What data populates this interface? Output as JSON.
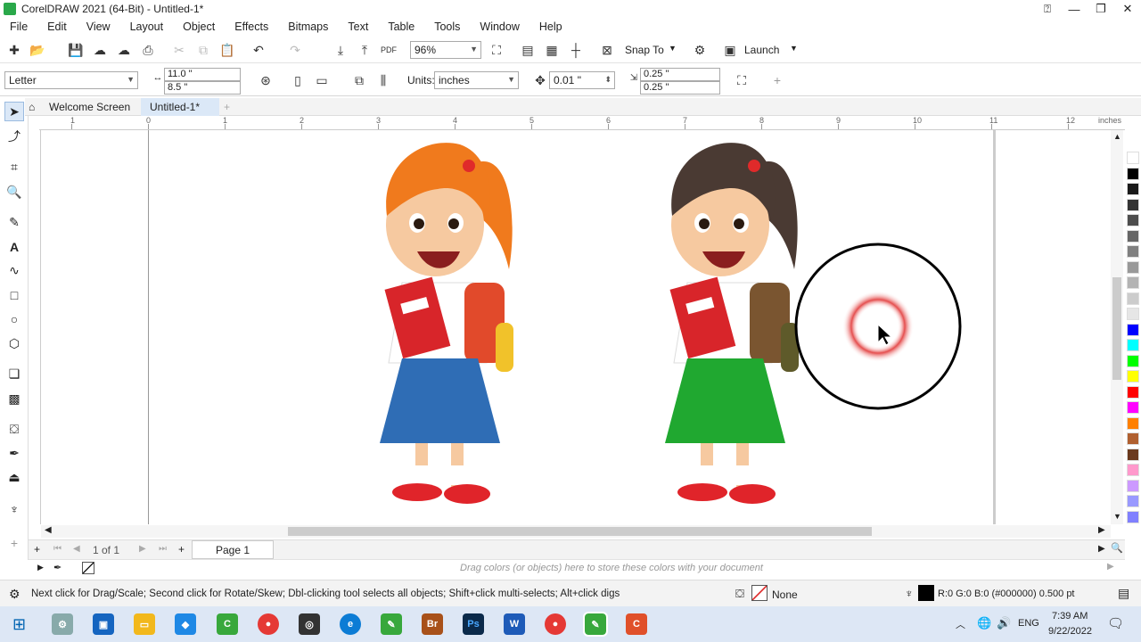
{
  "window": {
    "title": "CorelDRAW 2021 (64-Bit) - Untitled-1*"
  },
  "menu": [
    "File",
    "Edit",
    "View",
    "Layout",
    "Object",
    "Effects",
    "Bitmaps",
    "Text",
    "Table",
    "Tools",
    "Window",
    "Help"
  ],
  "standard_toolbar": {
    "zoom_value": "96%",
    "snap_to_label": "Snap To",
    "launch_label": "Launch"
  },
  "property_bar": {
    "page_size": "Letter",
    "width": "11.0 \"",
    "height": "8.5 \"",
    "units_label": "Units:",
    "units_value": "inches",
    "nudge": "0.01 \"",
    "dup_x": "0.25 \"",
    "dup_y": "0.25 \""
  },
  "doc_tabs": [
    {
      "label": "Welcome Screen"
    },
    {
      "label": "Untitled-1*"
    }
  ],
  "ruler": {
    "unit_label": "inches",
    "h_labels": [
      "1",
      "0",
      "1",
      "2",
      "3",
      "4",
      "5",
      "6",
      "7",
      "8",
      "9",
      "10",
      "11",
      "12"
    ]
  },
  "page_nav": {
    "page_count": "1  of  1",
    "page_tab": "Page 1"
  },
  "doc_palette_hint": "Drag colors (or objects) here to store these colors with your document",
  "status": {
    "hint": "Next click for Drag/Scale; Second click for Rotate/Skew; Dbl-clicking tool selects all objects; Shift+click multi-selects; Alt+click digs",
    "fill": "None",
    "outline": "R:0 G:0 B:0 (#000000)  0.500 pt"
  },
  "palette_colors": [
    "#ffffff",
    "#000000",
    "#1a1a1a",
    "#333333",
    "#4d4d4d",
    "#666666",
    "#808080",
    "#999999",
    "#b3b3b3",
    "#cccccc",
    "#e6e6e6",
    "#0000ff",
    "#00ffff",
    "#00ff00",
    "#ffff00",
    "#ff0000",
    "#ff00ff",
    "#ff8000",
    "#b06030",
    "#6b3a1e",
    "#ff99cc",
    "#cc99ff",
    "#9999ff",
    "#8080ff"
  ],
  "taskbar": {
    "language": "ENG",
    "time": "7:39 AM",
    "date": "9/22/2022"
  },
  "canvas": {
    "characters": [
      {
        "name": "girl-orange-hair",
        "hair": "#f07a1d",
        "skirt": "#2f6db5",
        "bag": "#e14a2b"
      },
      {
        "name": "girl-brown-hair",
        "hair": "#4a3a33",
        "skirt": "#20a830",
        "bag": "#7a5530"
      }
    ],
    "cursor_highlight": "#e23a3a"
  }
}
